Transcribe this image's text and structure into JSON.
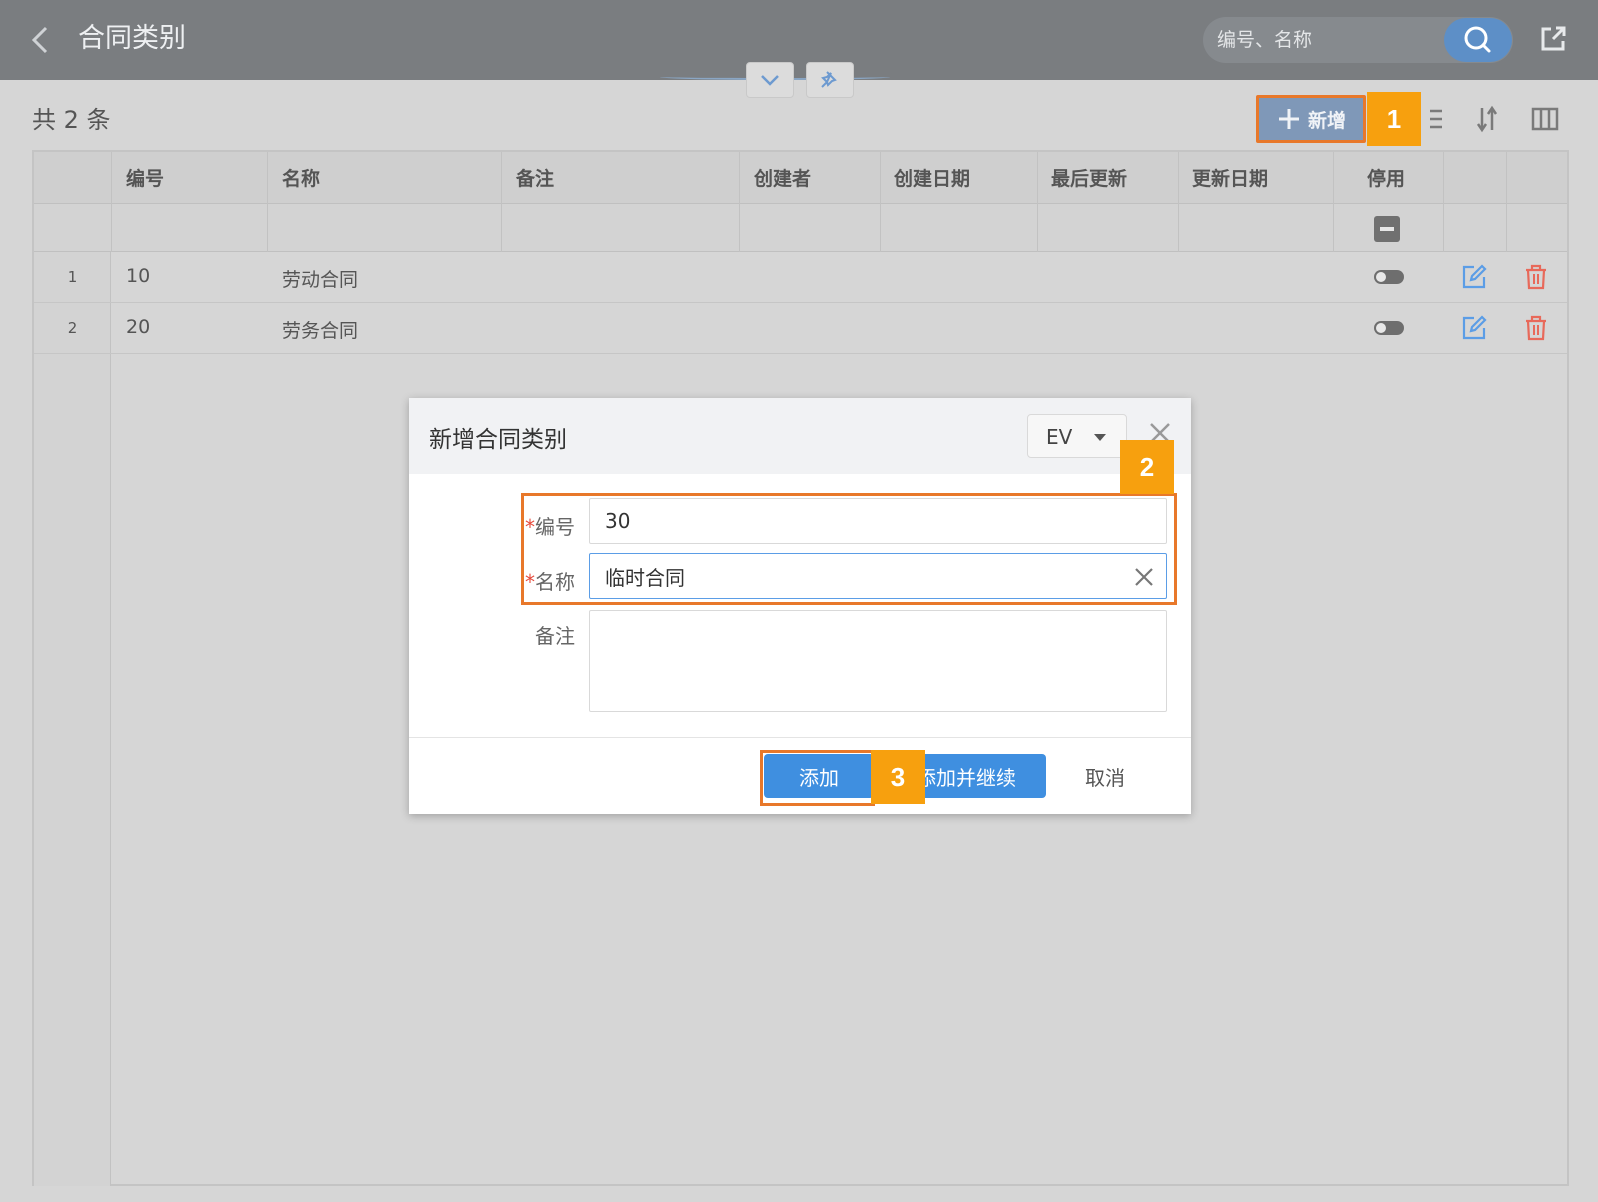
{
  "header": {
    "title": "合同类别",
    "search_placeholder": "编号、名称"
  },
  "toolbar": {
    "count_label": "共 2 条",
    "add_label": "新增"
  },
  "table": {
    "columns": [
      "编号",
      "名称",
      "备注",
      "创建者",
      "创建日期",
      "最后更新",
      "更新日期",
      "停用"
    ],
    "rows": [
      {
        "index": "1",
        "code": "10",
        "name": "劳动合同",
        "disabled": false
      },
      {
        "index": "2",
        "code": "20",
        "name": "劳务合同",
        "disabled": false
      }
    ]
  },
  "dialog": {
    "title": "新增合同类别",
    "language": "EV",
    "fields": {
      "code_label": "编号",
      "code_value": "30",
      "name_label": "名称",
      "name_value": "临时合同",
      "remarks_label": "备注",
      "remarks_value": "",
      "required_mark": "*"
    },
    "buttons": {
      "add": "添加",
      "add_continue": "添加并继续",
      "cancel": "取消"
    }
  },
  "annotations": [
    "1",
    "2",
    "3"
  ],
  "colors": {
    "header_bg": "#7a7d80",
    "primary": "#3f8fe0",
    "highlight": "#e8782a",
    "badge": "#f7a00e",
    "delete_icon": "#e8695a",
    "edit_icon": "#5b9de6"
  }
}
